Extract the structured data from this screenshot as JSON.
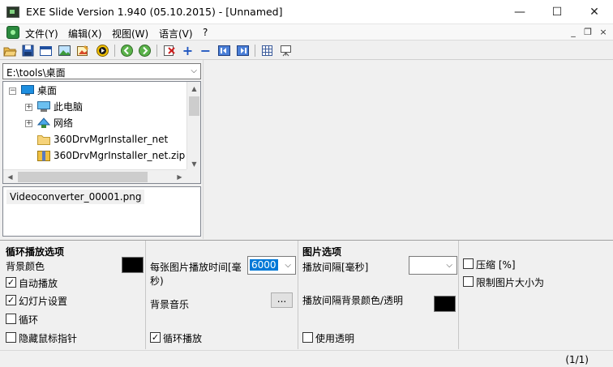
{
  "window": {
    "title": "EXE Slide Version 1.940 (05.10.2015) - [Unnamed]",
    "minimize_glyph": "—",
    "maximize_glyph": "☐",
    "close_glyph": "✕"
  },
  "menu": {
    "items": [
      "文件(Y)",
      "编辑(X)",
      "视图(W)",
      "语言(V)",
      "?"
    ],
    "mdi_minimize": "_",
    "mdi_restore": "❐",
    "mdi_close": "×"
  },
  "toolbar": {
    "buttons": [
      "open-folder-icon",
      "save-icon",
      "window-icon",
      "image-icon",
      "image-edit-icon",
      "play-icon",
      "prev-icon",
      "next-icon",
      "delete-icon",
      "add-icon",
      "remove-icon",
      "move-left-icon",
      "move-right-icon",
      "grid-icon",
      "presentation-icon"
    ],
    "add_glyph": "+",
    "remove_glyph": "−"
  },
  "browser": {
    "path": "E:\\tools\\桌面",
    "tree": [
      {
        "label": "桌面",
        "level": 0,
        "icon": "desktop"
      },
      {
        "label": "此电脑",
        "level": 1,
        "icon": "computer"
      },
      {
        "label": "网络",
        "level": 1,
        "icon": "network"
      },
      {
        "label": "360DrvMgrInstaller_net",
        "level": 1,
        "icon": "folder"
      },
      {
        "label": "360DrvMgrInstaller_net.zip",
        "level": 1,
        "icon": "archive"
      }
    ],
    "files": [
      "Videoconverter_00001.png"
    ]
  },
  "options": {
    "loop": {
      "title": "循环播放选项",
      "bg_color_label": "背景颜色",
      "bg_color": "#000000",
      "autoplay": {
        "label": "自动播放",
        "checked": true
      },
      "slideshow": {
        "label": "幻灯片设置",
        "checked": true
      },
      "loop": {
        "label": "循环",
        "checked": false
      },
      "hide_cursor": {
        "label": "隐藏鼠标指针",
        "checked": false
      }
    },
    "timing": {
      "interval_label_line1": "每张图片播放时间[毫",
      "interval_label_line2": "秒)",
      "interval_value": "6000",
      "music_label": "背景音乐",
      "browse_label": "...",
      "loop_play": {
        "label": "循环播放",
        "checked": true
      }
    },
    "image": {
      "title": "图片选项",
      "interval_label": "播放间隔[毫秒]",
      "interval_value": "",
      "bg_label": "播放间隔背景颜色/透明",
      "bg_color": "#000000",
      "transparent": {
        "label": "使用透明",
        "checked": false
      }
    },
    "size": {
      "compress": {
        "label": "压缩 [%]",
        "checked": false
      },
      "limit": {
        "label": "限制图片大小为",
        "checked": false
      }
    }
  },
  "status": {
    "page": "(1/1)"
  },
  "glyphs": {
    "check": "✓",
    "dropdown": "⌵",
    "expand_open": "−",
    "expand_closed": "+",
    "arrow_up": "▲",
    "arrow_down": "▼",
    "arrow_left": "◀",
    "arrow_right": "▶"
  }
}
